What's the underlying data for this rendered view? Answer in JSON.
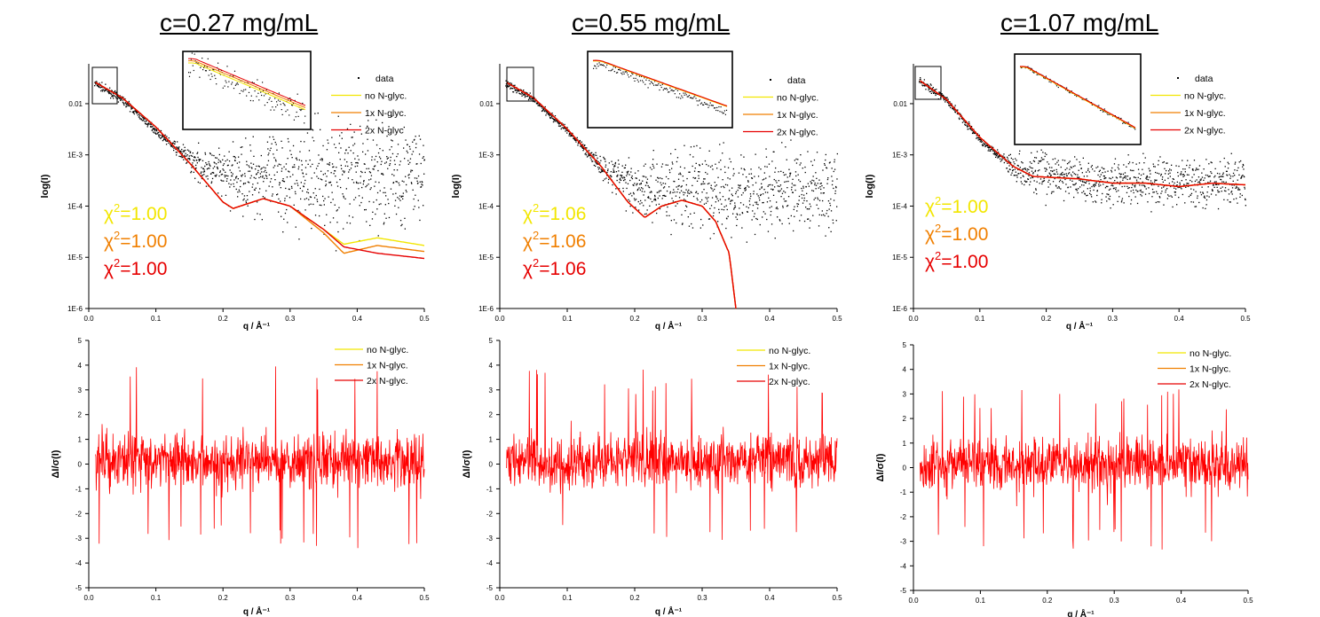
{
  "colors": {
    "data": "#000000",
    "no_glyc": "#f2e600",
    "one_glyc": "#f07f00",
    "two_glyc": "#e60000",
    "residual": "#ff0000"
  },
  "panels": [
    {
      "title": "c=0.27 mg/mL",
      "chi": [
        {
          "prefix": "χ",
          "sup": "2",
          "value": "=1.00"
        },
        {
          "prefix": "χ",
          "sup": "2",
          "value": "=1.00"
        },
        {
          "prefix": "χ",
          "sup": "2",
          "value": "=1.00"
        }
      ]
    },
    {
      "title": "c=0.55 mg/mL",
      "chi": [
        {
          "prefix": "χ",
          "sup": "2",
          "value": "=1.06"
        },
        {
          "prefix": "χ",
          "sup": "2",
          "value": "=1.06"
        },
        {
          "prefix": "χ",
          "sup": "2",
          "value": "=1.06"
        }
      ]
    },
    {
      "title": "c=1.07 mg/mL",
      "chi": [
        {
          "prefix": "χ",
          "sup": "2",
          "value": "=1.00"
        },
        {
          "prefix": "χ",
          "sup": "2",
          "value": "=1.00"
        },
        {
          "prefix": "χ",
          "sup": "2",
          "value": "=1.00"
        }
      ]
    }
  ],
  "chart_data": [
    {
      "panel": 0,
      "kind": "saxs",
      "type": "scatter",
      "xlabel": "q / Å⁻¹",
      "ylabel": "log(I)",
      "log_y": true,
      "xlim": [
        0,
        0.5
      ],
      "ylim": [
        1e-06,
        0.06
      ],
      "x_ticks": [
        "0.0",
        "0.1",
        "0.2",
        "0.3",
        "0.4",
        "0.5"
      ],
      "y_ticks": [
        {
          "v": 1e-06,
          "label": "1E-6"
        },
        {
          "v": 1e-05,
          "label": "1E-5"
        },
        {
          "v": 0.0001,
          "label": "1E-4"
        },
        {
          "v": 0.001,
          "label": "1E-3"
        },
        {
          "v": 0.01,
          "label": "0.01"
        }
      ],
      "legend": [
        "data",
        "no N-glyc.",
        "1x N-glyc.",
        "2x N-glyc"
      ],
      "noise_floor": 0.0004,
      "noise_spread": 1.2,
      "series": [
        {
          "name": "data",
          "points": [
            [
              0.01,
              0.025
            ],
            [
              0.05,
              0.012
            ],
            [
              0.1,
              0.003
            ],
            [
              0.15,
              0.0008
            ],
            [
              0.2,
              0.0004
            ],
            [
              0.3,
              0.0004
            ],
            [
              0.4,
              0.0004
            ],
            [
              0.5,
              0.0004
            ]
          ]
        },
        {
          "name": "no N-glyc.",
          "points": [
            [
              0.01,
              0.026
            ],
            [
              0.05,
              0.013
            ],
            [
              0.1,
              0.0035
            ],
            [
              0.15,
              0.0007
            ],
            [
              0.2,
              0.00012
            ],
            [
              0.215,
              9e-05
            ],
            [
              0.26,
              0.00014
            ],
            [
              0.3,
              0.0001
            ],
            [
              0.35,
              3.5e-05
            ],
            [
              0.38,
              1.8e-05
            ],
            [
              0.43,
              2.4e-05
            ],
            [
              0.5,
              1.7e-05
            ]
          ]
        },
        {
          "name": "1x N-glyc.",
          "points": [
            [
              0.01,
              0.026
            ],
            [
              0.05,
              0.013
            ],
            [
              0.1,
              0.0035
            ],
            [
              0.15,
              0.0007
            ],
            [
              0.2,
              0.00012
            ],
            [
              0.215,
              9e-05
            ],
            [
              0.26,
              0.00014
            ],
            [
              0.3,
              0.0001
            ],
            [
              0.35,
              3e-05
            ],
            [
              0.38,
              1.2e-05
            ],
            [
              0.43,
              1.7e-05
            ],
            [
              0.5,
              1.3e-05
            ]
          ]
        },
        {
          "name": "2x N-glyc",
          "points": [
            [
              0.01,
              0.026
            ],
            [
              0.05,
              0.013
            ],
            [
              0.1,
              0.0035
            ],
            [
              0.15,
              0.0007
            ],
            [
              0.2,
              0.00012
            ],
            [
              0.215,
              9e-05
            ],
            [
              0.26,
              0.00014
            ],
            [
              0.3,
              0.0001
            ],
            [
              0.35,
              3.5e-05
            ],
            [
              0.38,
              1.6e-05
            ],
            [
              0.43,
              1.2e-05
            ],
            [
              0.5,
              9.5e-06
            ]
          ]
        }
      ]
    },
    {
      "panel": 1,
      "kind": "saxs",
      "type": "scatter",
      "xlabel": "q / Å⁻¹",
      "ylabel": "log(I)",
      "log_y": true,
      "xlim": [
        0,
        0.5
      ],
      "ylim": [
        1e-06,
        0.06
      ],
      "x_ticks": [
        "0.0",
        "0.1",
        "0.2",
        "0.3",
        "0.4",
        "0.5"
      ],
      "y_ticks": [
        {
          "v": 1e-06,
          "label": "1E-6"
        },
        {
          "v": 1e-05,
          "label": "1E-5"
        },
        {
          "v": 0.0001,
          "label": "1E-4"
        },
        {
          "v": 0.001,
          "label": "1E-3"
        },
        {
          "v": 0.01,
          "label": "0.01"
        }
      ],
      "legend": [
        "data",
        "no N-glyc.",
        "1x N-glyc.",
        "2x N-glyc."
      ],
      "noise_floor": 0.0002,
      "noise_spread": 0.9,
      "series": [
        {
          "name": "data",
          "points": [
            [
              0.01,
              0.025
            ],
            [
              0.05,
              0.012
            ],
            [
              0.1,
              0.003
            ],
            [
              0.15,
              0.0006
            ],
            [
              0.2,
              0.00025
            ],
            [
              0.3,
              0.0002
            ],
            [
              0.4,
              0.0002
            ],
            [
              0.5,
              0.0002
            ]
          ]
        },
        {
          "name": "no N-glyc.",
          "points": [
            [
              0.01,
              0.026
            ],
            [
              0.05,
              0.013
            ],
            [
              0.1,
              0.0032
            ],
            [
              0.15,
              0.0006
            ],
            [
              0.19,
              0.00012
            ],
            [
              0.215,
              6e-05
            ],
            [
              0.24,
              0.0001
            ],
            [
              0.27,
              0.00013
            ],
            [
              0.3,
              0.0001
            ],
            [
              0.32,
              5e-05
            ],
            [
              0.34,
              1.2e-05
            ],
            [
              0.35,
              1e-06
            ]
          ]
        },
        {
          "name": "1x N-glyc.",
          "points": [
            [
              0.01,
              0.026
            ],
            [
              0.05,
              0.013
            ],
            [
              0.1,
              0.0032
            ],
            [
              0.15,
              0.0006
            ],
            [
              0.19,
              0.00012
            ],
            [
              0.215,
              6e-05
            ],
            [
              0.24,
              0.0001
            ],
            [
              0.27,
              0.00013
            ],
            [
              0.3,
              0.0001
            ],
            [
              0.32,
              5e-05
            ],
            [
              0.34,
              1.2e-05
            ],
            [
              0.35,
              1e-06
            ]
          ]
        },
        {
          "name": "2x N-glyc.",
          "points": [
            [
              0.01,
              0.026
            ],
            [
              0.05,
              0.013
            ],
            [
              0.1,
              0.0032
            ],
            [
              0.15,
              0.0006
            ],
            [
              0.19,
              0.00012
            ],
            [
              0.215,
              6e-05
            ],
            [
              0.24,
              0.0001
            ],
            [
              0.27,
              0.00013
            ],
            [
              0.3,
              0.0001
            ],
            [
              0.32,
              5e-05
            ],
            [
              0.34,
              1.2e-05
            ],
            [
              0.35,
              1e-06
            ]
          ]
        }
      ]
    },
    {
      "panel": 2,
      "kind": "saxs",
      "type": "scatter",
      "xlabel": "q / Å⁻¹",
      "ylabel": "log(I)",
      "log_y": true,
      "xlim": [
        0,
        0.5
      ],
      "ylim": [
        1e-06,
        0.06
      ],
      "x_ticks": [
        "0.0",
        "0.1",
        "0.2",
        "0.3",
        "0.4",
        "0.5"
      ],
      "y_ticks": [
        {
          "v": 1e-06,
          "label": "1E-6"
        },
        {
          "v": 1e-05,
          "label": "1E-5"
        },
        {
          "v": 0.0001,
          "label": "1E-4"
        },
        {
          "v": 0.001,
          "label": "1E-3"
        },
        {
          "v": 0.01,
          "label": "0.01"
        }
      ],
      "legend": [
        "data",
        "no N-glyc.",
        "1x N-glyc.",
        "2x N-glyc."
      ],
      "noise_floor": 0.0003,
      "noise_spread": 0.5,
      "series": [
        {
          "name": "data",
          "points": [
            [
              0.01,
              0.028
            ],
            [
              0.05,
              0.012
            ],
            [
              0.1,
              0.002
            ],
            [
              0.15,
              0.0006
            ],
            [
              0.2,
              0.0004
            ],
            [
              0.3,
              0.0003
            ],
            [
              0.4,
              0.0003
            ],
            [
              0.5,
              0.0003
            ]
          ]
        },
        {
          "name": "no N-glyc.",
          "points": [
            [
              0.01,
              0.028
            ],
            [
              0.05,
              0.012
            ],
            [
              0.1,
              0.0022
            ],
            [
              0.15,
              0.0006
            ],
            [
              0.18,
              0.00038
            ],
            [
              0.25,
              0.00034
            ],
            [
              0.3,
              0.00028
            ],
            [
              0.35,
              0.00028
            ],
            [
              0.4,
              0.00024
            ],
            [
              0.45,
              0.00028
            ],
            [
              0.5,
              0.00026
            ]
          ]
        },
        {
          "name": "1x N-glyc.",
          "points": [
            [
              0.01,
              0.028
            ],
            [
              0.05,
              0.012
            ],
            [
              0.1,
              0.0022
            ],
            [
              0.15,
              0.0006
            ],
            [
              0.18,
              0.00038
            ],
            [
              0.25,
              0.00034
            ],
            [
              0.3,
              0.00028
            ],
            [
              0.35,
              0.00028
            ],
            [
              0.4,
              0.00024
            ],
            [
              0.45,
              0.00028
            ],
            [
              0.5,
              0.00026
            ]
          ]
        },
        {
          "name": "2x N-glyc.",
          "points": [
            [
              0.01,
              0.028
            ],
            [
              0.05,
              0.012
            ],
            [
              0.1,
              0.0022
            ],
            [
              0.15,
              0.0006
            ],
            [
              0.18,
              0.00038
            ],
            [
              0.25,
              0.00034
            ],
            [
              0.3,
              0.00028
            ],
            [
              0.35,
              0.00028
            ],
            [
              0.4,
              0.00024
            ],
            [
              0.45,
              0.00028
            ],
            [
              0.5,
              0.00026
            ]
          ]
        }
      ]
    },
    {
      "panel": 0,
      "kind": "residual",
      "type": "line",
      "xlabel": "q / Å⁻¹",
      "ylabel": "ΔI/σ(I)",
      "xlim": [
        0,
        0.5
      ],
      "ylim": [
        -5,
        5
      ],
      "x_ticks": [
        "0.0",
        "0.1",
        "0.2",
        "0.3",
        "0.4",
        "0.5"
      ],
      "y_ticks": [
        "-5",
        "-4",
        "-3",
        "-2",
        "-1",
        "0",
        "1",
        "2",
        "3",
        "4",
        "5"
      ],
      "legend": [
        "no N-glyc.",
        "1x N-glyc.",
        "2x N-glyc."
      ],
      "residual_range": [
        0.01,
        0.5
      ],
      "residual_min": -3.5,
      "residual_max": 4.0
    },
    {
      "panel": 1,
      "kind": "residual",
      "type": "line",
      "xlabel": "q / Å⁻¹",
      "ylabel": "ΔI/σ(I)",
      "xlim": [
        0,
        0.5
      ],
      "ylim": [
        -5,
        5
      ],
      "x_ticks": [
        "0.0",
        "0.1",
        "0.2",
        "0.3",
        "0.4",
        "0.5"
      ],
      "y_ticks": [
        "-5",
        "-4",
        "-3",
        "-2",
        "-1",
        "0",
        "1",
        "2",
        "3",
        "4",
        "5"
      ],
      "legend": [
        "no N-glyc.",
        "1x N-glyc.",
        "2x N-glyc."
      ],
      "residual_range": [
        0.01,
        0.5
      ],
      "residual_min": -3.3,
      "residual_max": 3.9
    },
    {
      "panel": 2,
      "kind": "residual",
      "type": "line",
      "xlabel": "q / Å⁻¹",
      "ylabel": "ΔI/σ(I)",
      "xlim": [
        0,
        0.5
      ],
      "ylim": [
        -5,
        5
      ],
      "x_ticks": [
        "0.0",
        "0.1",
        "0.2",
        "0.3",
        "0.4",
        "0.5"
      ],
      "y_ticks": [
        "-5",
        "-4",
        "-3",
        "-2",
        "-1",
        "0",
        "1",
        "2",
        "3",
        "4",
        "5"
      ],
      "legend": [
        "no N-glyc.",
        "1x N-glyc.",
        "2x N-glyc."
      ],
      "residual_range": [
        0.01,
        0.5
      ],
      "residual_min": -3.4,
      "residual_max": 3.3
    }
  ]
}
